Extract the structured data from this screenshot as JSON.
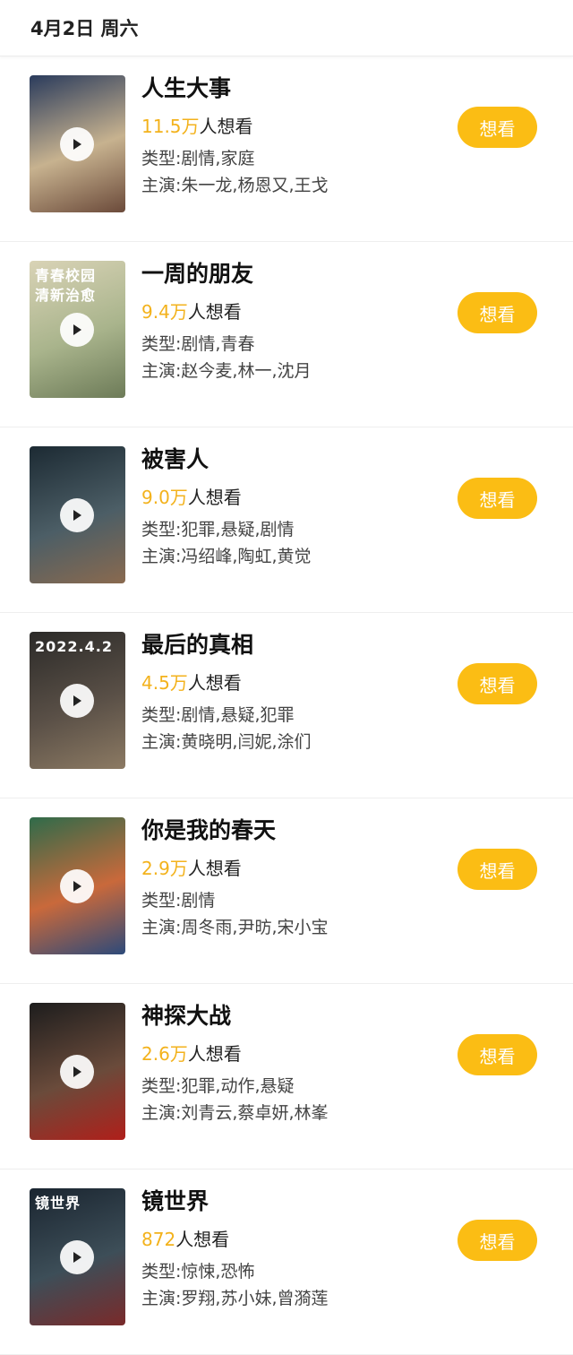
{
  "header": {
    "date": "4月2日 周六"
  },
  "icons": {
    "play": "play-icon"
  },
  "colors": {
    "accent": "#fbbd14",
    "count": "#f3b21c"
  },
  "movies": [
    {
      "title": "人生大事",
      "want_count": "11.5万",
      "want_suffix": "人想看",
      "genre": "类型:剧情,家庭",
      "cast": "主演:朱一龙,杨恩又,王戈",
      "button": "想看",
      "poster_text": "",
      "poster_colors": [
        "#2a3b5c",
        "#c7b28f",
        "#6b4a3a"
      ]
    },
    {
      "title": "一周的朋友",
      "want_count": "9.4万",
      "want_suffix": "人想看",
      "genre": "类型:剧情,青春",
      "cast": "主演:赵今麦,林一,沈月",
      "button": "想看",
      "poster_text": "青春校园\n清新治愈",
      "poster_colors": [
        "#d9d3b6",
        "#a9b48c",
        "#6d7b58"
      ]
    },
    {
      "title": "被害人",
      "want_count": "9.0万",
      "want_suffix": "人想看",
      "genre": "类型:犯罪,悬疑,剧情",
      "cast": "主演:冯绍峰,陶虹,黄觉",
      "button": "想看",
      "poster_text": "",
      "poster_colors": [
        "#1c2a33",
        "#4c5e66",
        "#8a6a4f"
      ]
    },
    {
      "title": "最后的真相",
      "want_count": "4.5万",
      "want_suffix": "人想看",
      "genre": "类型:剧情,悬疑,犯罪",
      "cast": "主演:黄晓明,闫妮,涂们",
      "button": "想看",
      "poster_text": "2022.4.2",
      "poster_colors": [
        "#2b2a28",
        "#5a5047",
        "#8c7a63"
      ]
    },
    {
      "title": "你是我的春天",
      "want_count": "2.9万",
      "want_suffix": "人想看",
      "genre": "类型:剧情",
      "cast": "主演:周冬雨,尹昉,宋小宝",
      "button": "想看",
      "poster_text": "",
      "poster_colors": [
        "#2f6b4a",
        "#c9693b",
        "#2d4a7a"
      ]
    },
    {
      "title": "神探大战",
      "want_count": "2.6万",
      "want_suffix": "人想看",
      "genre": "类型:犯罪,动作,悬疑",
      "cast": "主演:刘青云,蔡卓妍,林峯",
      "button": "想看",
      "poster_text": "",
      "poster_colors": [
        "#1d1d1d",
        "#6a4b3b",
        "#b01f1a"
      ]
    },
    {
      "title": "镜世界",
      "want_count": "872",
      "want_suffix": "人想看",
      "genre": "类型:惊悚,恐怖",
      "cast": "主演:罗翔,苏小妹,曾漪莲",
      "button": "想看",
      "poster_text": "镜世界",
      "poster_colors": [
        "#1a2530",
        "#3d4e58",
        "#7a2a2a"
      ]
    }
  ]
}
